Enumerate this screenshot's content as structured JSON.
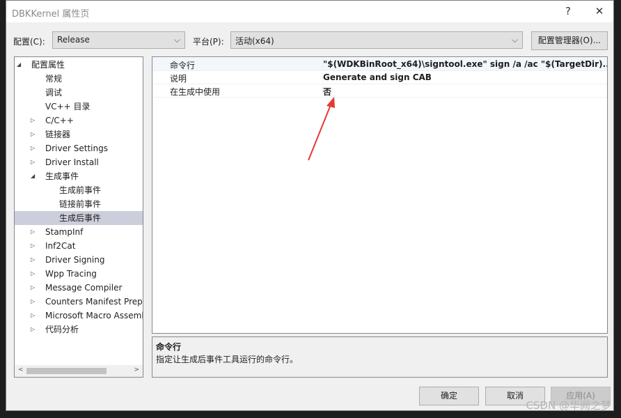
{
  "window": {
    "title": "DBKKernel 属性页",
    "help": "?",
    "close": "✕"
  },
  "config": {
    "label": "配置(C):",
    "value": "Release",
    "platform_label": "平台(P):",
    "platform_value": "活动(x64)",
    "manager": "配置管理器(O)..."
  },
  "tree": [
    {
      "label": "配置属性",
      "level": 0,
      "expand": "open"
    },
    {
      "label": "常规",
      "level": 1,
      "expand": ""
    },
    {
      "label": "调试",
      "level": 1,
      "expand": ""
    },
    {
      "label": "VC++ 目录",
      "level": 1,
      "expand": ""
    },
    {
      "label": "C/C++",
      "level": 1,
      "expand": "closed"
    },
    {
      "label": "链接器",
      "level": 1,
      "expand": "closed"
    },
    {
      "label": "Driver Settings",
      "level": 1,
      "expand": "closed"
    },
    {
      "label": "Driver Install",
      "level": 1,
      "expand": "closed"
    },
    {
      "label": "生成事件",
      "level": 1,
      "expand": "open"
    },
    {
      "label": "生成前事件",
      "level": 2,
      "expand": ""
    },
    {
      "label": "链接前事件",
      "level": 2,
      "expand": ""
    },
    {
      "label": "生成后事件",
      "level": 2,
      "expand": "",
      "selected": true
    },
    {
      "label": "StampInf",
      "level": 1,
      "expand": "closed"
    },
    {
      "label": "Inf2Cat",
      "level": 1,
      "expand": "closed"
    },
    {
      "label": "Driver Signing",
      "level": 1,
      "expand": "closed"
    },
    {
      "label": "Wpp Tracing",
      "level": 1,
      "expand": "closed"
    },
    {
      "label": "Message Compiler",
      "level": 1,
      "expand": "closed"
    },
    {
      "label": "Counters Manifest Preprocessor",
      "level": 1,
      "expand": "closed"
    },
    {
      "label": "Microsoft Macro Assembler",
      "level": 1,
      "expand": "closed"
    },
    {
      "label": "代码分析",
      "level": 1,
      "expand": "closed"
    }
  ],
  "properties": [
    {
      "name": "命令行",
      "value": "\"$(WDKBinRoot_x64)\\signtool.exe\" sign /a /ac \"$(TargetDir)..\\release"
    },
    {
      "name": "说明",
      "value": "Generate and sign CAB"
    },
    {
      "name": "在生成中使用",
      "value": "否"
    }
  ],
  "description": {
    "title": "命令行",
    "text": "指定让生成后事件工具运行的命令行。"
  },
  "buttons": {
    "ok": "确定",
    "cancel": "取消",
    "apply": "应用(A)"
  },
  "watermark": "CSDN @华阙之梦",
  "annotation_color": "#e53935"
}
